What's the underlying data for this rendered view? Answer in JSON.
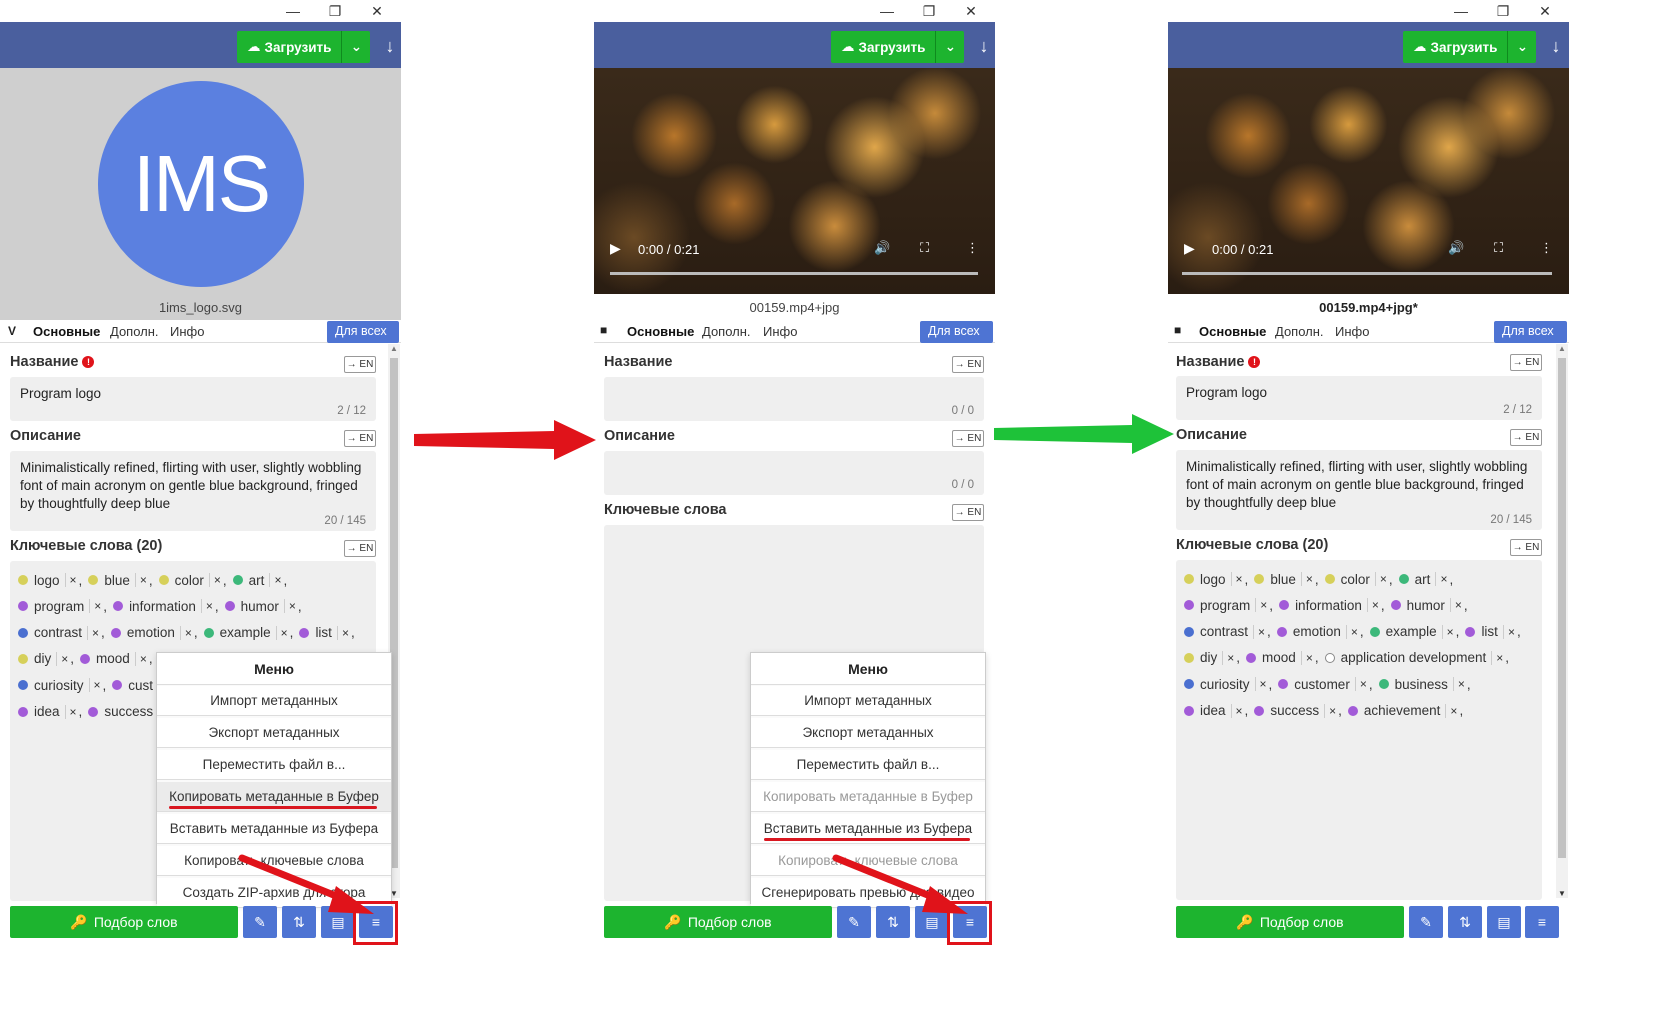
{
  "window_controls": {
    "minimize": "—",
    "maximize": "❐",
    "close": "✕"
  },
  "upload": {
    "label": "Загрузить"
  },
  "panels": [
    {
      "filename": "1ims_logo.svg",
      "logo_text": "IMS",
      "tabs": [
        "Основные",
        "Дополн.",
        "Инфо"
      ],
      "for_all": "Для всех ⌄",
      "title_label": "Название",
      "title_value": "Program logo",
      "title_counter": "2 / 12",
      "desc_label": "Описание",
      "desc_value": "Minimalistically refined, flirting with user, slightly wobbling font of main acronym on gentle blue background, fringed by thoughtfully deep blue",
      "desc_counter": "20 / 145",
      "kw_label": "Ключевые слова (20)",
      "keywords": [
        {
          "t": "logo",
          "c": "#d6d05a"
        },
        {
          "t": "blue",
          "c": "#d6d05a"
        },
        {
          "t": "color",
          "c": "#d6d05a"
        },
        {
          "t": "art",
          "c": "#3cb87a"
        },
        {
          "t": "program",
          "c": "#a25bd8"
        },
        {
          "t": "information",
          "c": "#a25bd8"
        },
        {
          "t": "humor",
          "c": "#a25bd8"
        },
        {
          "t": "contrast",
          "c": "#4a6fd0"
        },
        {
          "t": "emotion",
          "c": "#a25bd8"
        },
        {
          "t": "example",
          "c": "#3cb87a"
        },
        {
          "t": "list",
          "c": "#a25bd8"
        },
        {
          "t": "diy",
          "c": "#d6d05a"
        },
        {
          "t": "mood",
          "c": "#a25bd8"
        },
        {
          "t": "curiosity",
          "c": "#4a6fd0"
        },
        {
          "t": "cust",
          "c": "#a25bd8"
        },
        {
          "t": "idea",
          "c": "#a25bd8"
        },
        {
          "t": "success",
          "c": "#a25bd8"
        }
      ],
      "menu": {
        "title": "Меню",
        "items": [
          {
            "label": "Импорт метаданных",
            "disabled": false
          },
          {
            "label": "Экспорт метаданных",
            "disabled": false
          },
          {
            "label": "Переместить файл в...",
            "disabled": false
          },
          {
            "label": "Копировать метаданные в Буфер",
            "disabled": false,
            "highlight": true
          },
          {
            "label": "Вставить метаданные из Буфера",
            "disabled": false
          },
          {
            "label": "Копировать ключевые слова",
            "disabled": false
          },
          {
            "label": "Создать ZIP-архив для стора",
            "disabled": false
          }
        ]
      },
      "match_words": "Подбор слов"
    },
    {
      "filename": "00159.mp4+jpg",
      "video_time": "0:00 / 0:21",
      "tabs": [
        "Основные",
        "Дополн.",
        "Инфо"
      ],
      "for_all": "Для всех ⌄",
      "title_label": "Название",
      "title_counter": "0 / 0",
      "desc_label": "Описание",
      "desc_counter": "0 / 0",
      "kw_label": "Ключевые слова",
      "menu": {
        "title": "Меню",
        "items": [
          {
            "label": "Импорт метаданных",
            "disabled": false
          },
          {
            "label": "Экспорт метаданных",
            "disabled": false
          },
          {
            "label": "Переместить файл в...",
            "disabled": false
          },
          {
            "label": "Копировать метаданные в Буфер",
            "disabled": true
          },
          {
            "label": "Вставить метаданные из Буфера",
            "disabled": false
          },
          {
            "label": "Копировать ключевые слова",
            "disabled": true
          },
          {
            "label": "Сгенерировать превью для видео",
            "disabled": false
          }
        ]
      },
      "match_words": "Подбор слов"
    },
    {
      "filename": "00159.mp4+jpg*",
      "video_time": "0:00 / 0:21",
      "tabs": [
        "Основные",
        "Дополн.",
        "Инфо"
      ],
      "for_all": "Для всех ⌄",
      "title_label": "Название",
      "title_value": "Program logo",
      "title_counter": "2 / 12",
      "desc_label": "Описание",
      "desc_value": "Minimalistically refined, flirting with user, slightly wobbling font of main acronym on gentle blue background, fringed by thoughtfully deep blue",
      "desc_counter": "20 / 145",
      "kw_label": "Ключевые слова (20)",
      "keywords": [
        {
          "t": "logo",
          "c": "#d6d05a"
        },
        {
          "t": "blue",
          "c": "#d6d05a"
        },
        {
          "t": "color",
          "c": "#d6d05a"
        },
        {
          "t": "art",
          "c": "#3cb87a"
        },
        {
          "t": "program",
          "c": "#a25bd8"
        },
        {
          "t": "information",
          "c": "#a25bd8"
        },
        {
          "t": "humor",
          "c": "#a25bd8"
        },
        {
          "t": "contrast",
          "c": "#4a6fd0"
        },
        {
          "t": "emotion",
          "c": "#a25bd8"
        },
        {
          "t": "example",
          "c": "#3cb87a"
        },
        {
          "t": "list",
          "c": "#a25bd8"
        },
        {
          "t": "diy",
          "c": "#d6d05a"
        },
        {
          "t": "mood",
          "c": "#a25bd8"
        },
        {
          "t": "application development",
          "c": "#ffffff"
        },
        {
          "t": "curiosity",
          "c": "#4a6fd0"
        },
        {
          "t": "customer",
          "c": "#a25bd8"
        },
        {
          "t": "business",
          "c": "#3cb87a"
        },
        {
          "t": "idea",
          "c": "#a25bd8"
        },
        {
          "t": "success",
          "c": "#a25bd8"
        },
        {
          "t": "achievement",
          "c": "#a25bd8"
        }
      ],
      "match_words": "Подбор слов"
    }
  ],
  "colors": {
    "toolbar": "#4a5f9e",
    "green": "#1db42f",
    "blue_btn": "#4e74d3",
    "red": "#e0131a",
    "arrow_red": "#e0131a",
    "arrow_green": "#1ec239"
  }
}
